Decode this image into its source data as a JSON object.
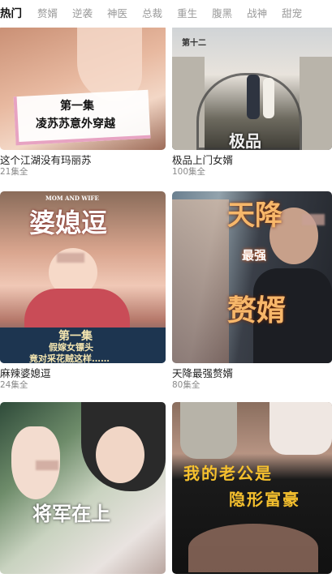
{
  "tabs": [
    {
      "label": "热门",
      "active": true
    },
    {
      "label": "赘婿",
      "active": false
    },
    {
      "label": "逆袭",
      "active": false
    },
    {
      "label": "神医",
      "active": false
    },
    {
      "label": "总裁",
      "active": false
    },
    {
      "label": "重生",
      "active": false
    },
    {
      "label": "腹黑",
      "active": false
    },
    {
      "label": "战神",
      "active": false
    },
    {
      "label": "甜宠",
      "active": false
    }
  ],
  "dramas": [
    {
      "title": "这个江湖没有玛丽苏",
      "episodes": "21集全",
      "poster_caption_1": "第一集",
      "poster_caption_2": "凌苏苏意外穿越"
    },
    {
      "title": "极品上门女婿",
      "episodes": "100集全",
      "poster_caption_1": "第十二",
      "poster_caption_2": "极品"
    },
    {
      "title": "麻辣婆媳逗",
      "episodes": "24集全",
      "poster_caption_0": "婆媳逗",
      "poster_caption_en": "MOM AND WIFE",
      "poster_caption_1": "第一集",
      "poster_caption_2": "假嫁女镖头",
      "poster_caption_3": "竟对采花贼这样……"
    },
    {
      "title": "天降最强赘婿",
      "episodes": "80集全",
      "poster_caption_1": "天降",
      "poster_caption_2": "最强",
      "poster_caption_3": "赘婿"
    },
    {
      "title": "",
      "episodes": "",
      "poster_caption_1": "将军在上"
    },
    {
      "title": "",
      "episodes": "",
      "poster_caption_1": "我的老公是",
      "poster_caption_2": "隐形富豪"
    }
  ]
}
